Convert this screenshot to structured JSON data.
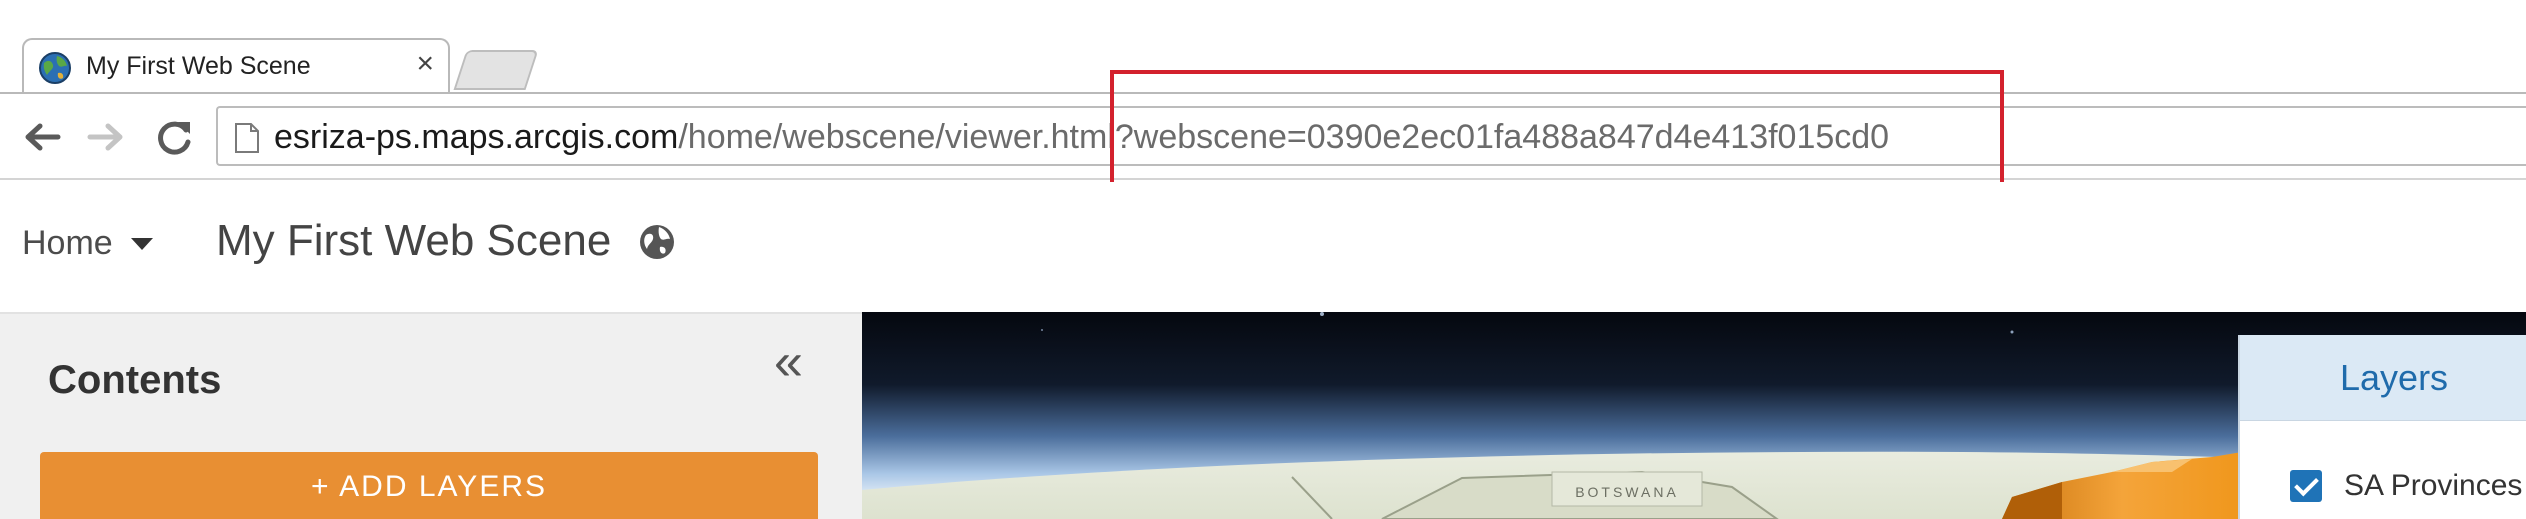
{
  "browser": {
    "tab_title": "My First Web Scene",
    "tab_close": "×",
    "url_host": "esriza-ps.maps.arcgis.com",
    "url_path": "/home/webscene/viewer.html?webscene=0390e2ec01fa488a847d4e413f015cd0"
  },
  "header": {
    "home_label": "Home",
    "scene_title": "My First Web Scene"
  },
  "contents": {
    "title": "Contents",
    "collapse_glyph": "«",
    "add_layers_label": "+ ADD LAYERS"
  },
  "layers": {
    "title": "Layers",
    "items": [
      {
        "label": "SA Provinces",
        "checked": true
      }
    ]
  },
  "map": {
    "country_label": "BOTSWANA"
  },
  "colors": {
    "accent_orange": "#e88f33",
    "layers_blue": "#1f6bab",
    "highlight_red": "#d3212d"
  }
}
